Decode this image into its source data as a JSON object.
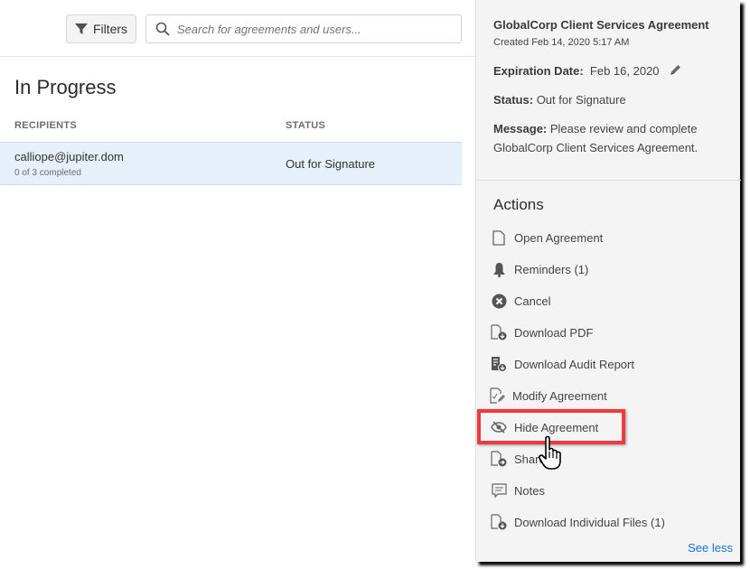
{
  "toolbar": {
    "filters_label": "Filters",
    "search_placeholder": "Search for agreements and users..."
  },
  "list": {
    "title": "In Progress",
    "columns": [
      "RECIPIENTS",
      "STATUS"
    ],
    "rows": [
      {
        "recipient": "calliope@jupiter.dom",
        "progress": "0 of 3 completed",
        "status": "Out for Signature"
      }
    ]
  },
  "panel": {
    "title": "GlobalCorp Client Services Agreement",
    "created": "Created Feb 14, 2020 5:17 AM",
    "expiration_label": "Expiration Date:",
    "expiration_value": "Feb 16, 2020",
    "status_label": "Status:",
    "status_value": "Out for Signature",
    "message_label": "Message:",
    "message_value": "Please review and complete GlobalCorp Client Services Agreement.",
    "actions_heading": "Actions",
    "actions": [
      {
        "label": "Open Agreement",
        "icon": "document-icon"
      },
      {
        "label": "Reminders (1)",
        "icon": "bell-icon"
      },
      {
        "label": "Cancel",
        "icon": "cancel-circle-icon"
      },
      {
        "label": "Download PDF",
        "icon": "pdf-download-icon"
      },
      {
        "label": "Download Audit Report",
        "icon": "audit-report-icon"
      },
      {
        "label": "Modify Agreement",
        "icon": "modify-document-icon"
      },
      {
        "label": "Hide Agreement",
        "icon": "eye-off-icon"
      },
      {
        "label": "Share",
        "icon": "share-document-icon"
      },
      {
        "label": "Notes",
        "icon": "notes-icon"
      },
      {
        "label": "Download Individual Files (1)",
        "icon": "file-download-icon"
      }
    ],
    "see_less": "See less"
  },
  "colors": {
    "accent": "#1473e6",
    "highlight": "#f0393d",
    "selected_row": "#e6f0fa"
  }
}
